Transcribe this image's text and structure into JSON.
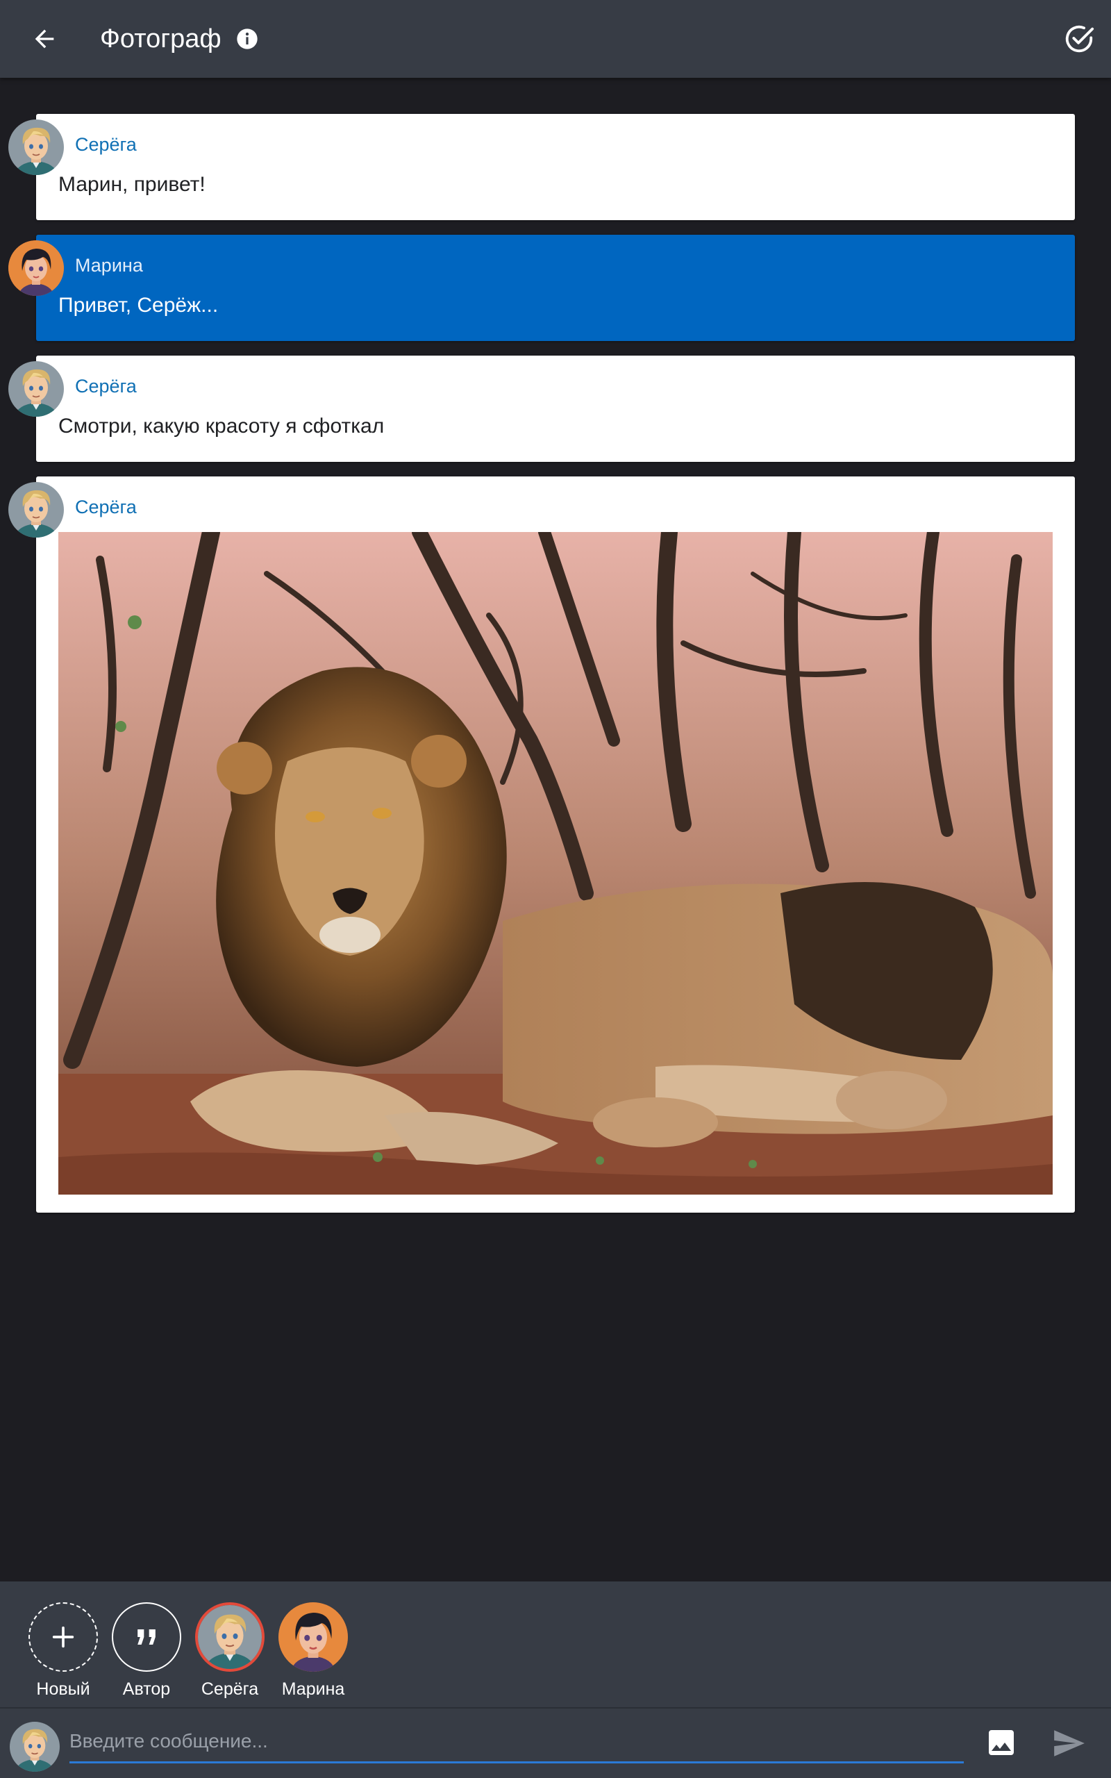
{
  "header": {
    "title": "Фотограф",
    "back_icon": "arrow-left-icon",
    "info_icon": "info-icon",
    "done_icon": "check-circle-icon"
  },
  "messages": [
    {
      "author": "Серёга",
      "text": "Марин, привет!",
      "mine": false,
      "avatar": "serega"
    },
    {
      "author": "Марина",
      "text": "Привет, Серёж...",
      "mine": true,
      "avatar": "marina"
    },
    {
      "author": "Серёга",
      "text": "Смотри, какую красоту я сфоткал",
      "mine": false,
      "avatar": "serega"
    },
    {
      "author": "Серёга",
      "text": "",
      "mine": false,
      "avatar": "serega",
      "attachment": "photo"
    }
  ],
  "characters": [
    {
      "label": "Новый",
      "icon": "plus-icon"
    },
    {
      "label": "Автор",
      "icon": "quote-icon"
    },
    {
      "label": "Серёга",
      "icon": "avatar-serega",
      "selected": true
    },
    {
      "label": "Марина",
      "icon": "avatar-marina"
    }
  ],
  "composer": {
    "placeholder": "Введите сообщение...",
    "image_icon": "image-icon",
    "send_icon": "send-icon"
  },
  "colors": {
    "header_bg": "#373c45",
    "background": "#1d1d22",
    "author_name": "#1070b4",
    "my_message_bg": "#0066c0",
    "selected_ring": "#e34a3a",
    "input_underline": "#2b7ad6"
  }
}
